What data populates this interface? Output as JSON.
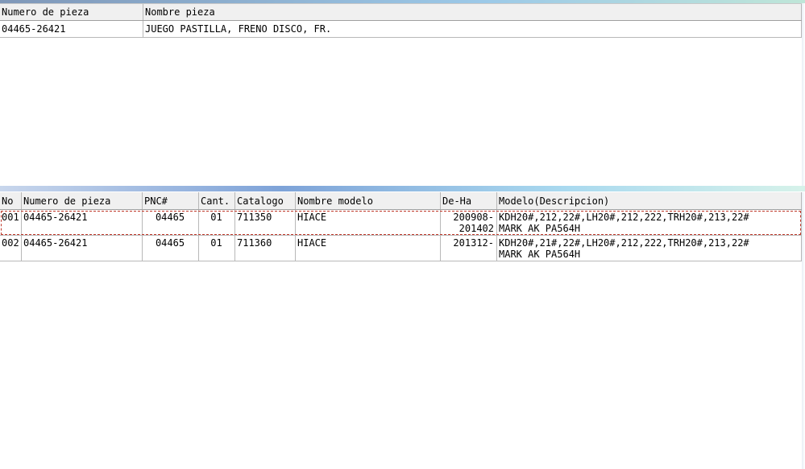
{
  "top_table": {
    "headers": [
      "Numero de pieza",
      "Nombre pieza"
    ],
    "rows": [
      {
        "part_number": "04465-26421",
        "part_name": "JUEGO PASTILLA, FRENO DISCO, FR."
      }
    ]
  },
  "bottom_table": {
    "headers": [
      "No",
      "Numero de pieza",
      "PNC#",
      "Cant.",
      "Catalogo",
      "Nombre modelo",
      "De-Ha",
      "Modelo(Descripcion)"
    ],
    "rows": [
      {
        "no": "001",
        "part_number": "04465-26421",
        "pnc": "04465",
        "qty": "01",
        "catalog": "711350",
        "model_name": "HIACE",
        "from_to_1": "200908-",
        "from_to_2": "201402",
        "desc_1": "KDH20#,212,22#,LH20#,212,222,TRH20#,213,22#",
        "desc_2": "MARK AK PA564H"
      },
      {
        "no": "002",
        "part_number": "04465-26421",
        "pnc": "04465",
        "qty": "01",
        "catalog": "711360",
        "model_name": "HIACE",
        "from_to_1": "201312-",
        "from_to_2": "",
        "desc_1": "KDH20#,21#,22#,LH20#,212,222,TRH20#,213,22#",
        "desc_2": "MARK AK PA564H"
      }
    ]
  }
}
